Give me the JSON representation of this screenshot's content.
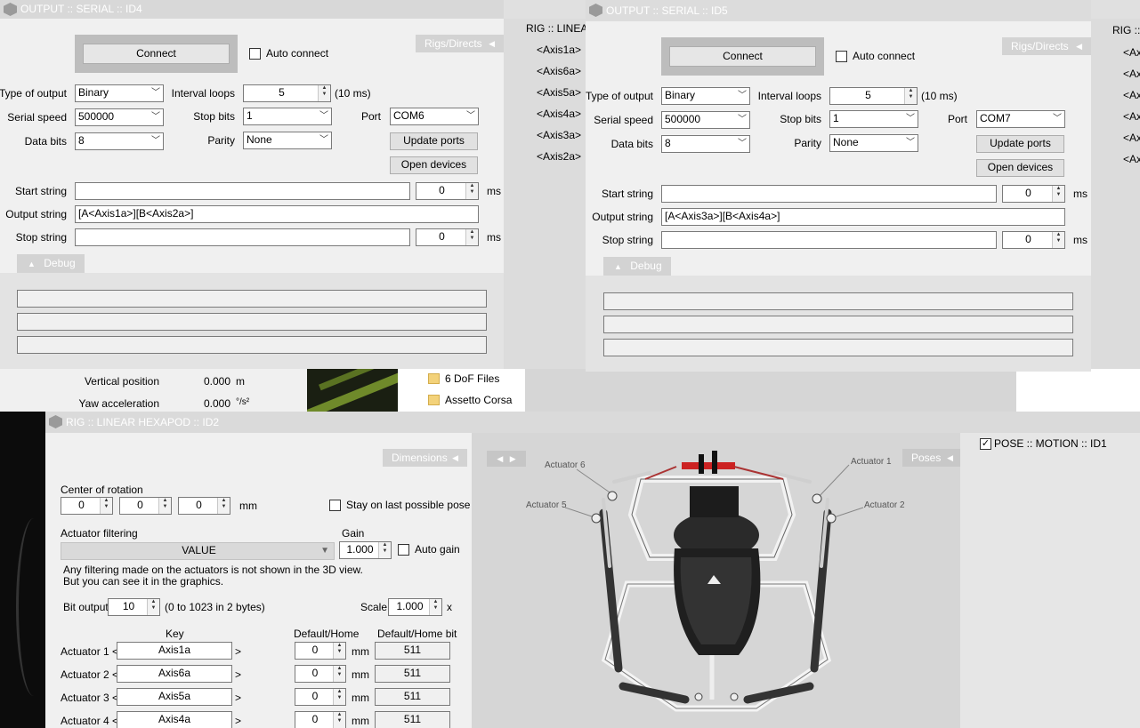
{
  "serial_id4": {
    "title": "OUTPUT :: SERIAL :: ID4",
    "connect_label": "Connect",
    "auto_connect_label": "Auto connect",
    "rigs_tab": "Rigs/Directs",
    "type_output_label": "Type of output",
    "type_output_value": "Binary",
    "interval_label": "Interval loops",
    "interval_value": "5",
    "interval_unit": "(10 ms)",
    "speed_label": "Serial speed",
    "speed_value": "500000",
    "stopbits_label": "Stop bits",
    "stopbits_value": "1",
    "port_label": "Port",
    "port_value": "COM6",
    "databits_label": "Data bits",
    "databits_value": "8",
    "parity_label": "Parity",
    "parity_value": "None",
    "update_ports_label": "Update ports",
    "open_devices_label": "Open devices",
    "start_label": "Start string",
    "start_value": "",
    "start_ms": "0",
    "output_label": "Output string",
    "output_value": "[A<Axis1a>][B<Axis2a>]",
    "stop_label": "Stop string",
    "stop_value": "",
    "stop_ms": "0",
    "ms": "ms",
    "debug_tab": "Debug"
  },
  "serial_id5": {
    "title": "OUTPUT :: SERIAL :: ID5",
    "connect_label": "Connect",
    "auto_connect_label": "Auto connect",
    "rigs_tab": "Rigs/Directs",
    "type_output_label": "Type of output",
    "type_output_value": "Binary",
    "interval_label": "Interval loops",
    "interval_value": "5",
    "interval_unit": "(10 ms)",
    "speed_label": "Serial speed",
    "speed_value": "500000",
    "stopbits_label": "Stop bits",
    "stopbits_value": "1",
    "port_label": "Port",
    "port_value": "COM7",
    "databits_label": "Data bits",
    "databits_value": "8",
    "parity_label": "Parity",
    "parity_value": "None",
    "update_ports_label": "Update ports",
    "open_devices_label": "Open devices",
    "start_label": "Start string",
    "start_value": "",
    "start_ms": "0",
    "output_label": "Output string",
    "output_value": "[A<Axis3a>][B<Axis4a>]",
    "stop_label": "Stop string",
    "stop_value": "",
    "stop_ms": "0",
    "ms": "ms",
    "debug_tab": "Debug"
  },
  "rig_list_left": {
    "title": "RIG :: LINEAF",
    "items": [
      "<Axis1a>",
      "<Axis6a>",
      "<Axis5a>",
      "<Axis4a>",
      "<Axis3a>",
      "<Axis2a>"
    ]
  },
  "rig_list_right": {
    "title": "RIG ::",
    "items": [
      "<Ax",
      "<Ax",
      "<Ax",
      "<Ax",
      "<Ax",
      "<Ax"
    ]
  },
  "telemetry": {
    "vertical_position_label": "Vertical position",
    "vertical_position_value": "0.000",
    "vertical_position_unit": "m",
    "yaw_accel_label": "Yaw acceleration",
    "yaw_accel_value": "0.000",
    "yaw_accel_unit": "°/s²"
  },
  "files": {
    "items": [
      "6 DoF Files",
      "Assetto Corsa"
    ]
  },
  "rig_id2": {
    "title": "RIG :: LINEAR HEXAPOD :: ID2",
    "dimensions_tab": "Dimensions",
    "poses_tab": "Poses",
    "center_label": "Center of rotation",
    "center_x": "0",
    "center_y": "0",
    "center_z": "0",
    "mm": "mm",
    "stay_label": "Stay on last possible pose",
    "filter_label": "Actuator filtering",
    "filter_value": "VALUE",
    "gain_label": "Gain",
    "gain_value": "1.000",
    "auto_gain_label": "Auto gain",
    "note_line1": "Any filtering made on the actuators is not shown in the 3D view.",
    "note_line2": "But you can see it in the graphics.",
    "bit_output_label": "Bit output",
    "bit_output_value": "10",
    "bit_output_range": "(0 to 1023 in 2 bytes)",
    "scale_label": "Scale",
    "scale_value": "1.000",
    "scale_unit": "x",
    "col_key": "Key",
    "col_default": "Default/Home",
    "col_default_bit": "Default/Home bit",
    "actuators": [
      {
        "label": "Actuator 1 <",
        "key": "Axis1a",
        "default": "0",
        "bit": "511"
      },
      {
        "label": "Actuator 2 <",
        "key": "Axis6a",
        "default": "0",
        "bit": "511"
      },
      {
        "label": "Actuator 3 <",
        "key": "Axis5a",
        "default": "0",
        "bit": "511"
      },
      {
        "label": "Actuator 4 <",
        "key": "Axis4a",
        "default": "0",
        "bit": "511"
      }
    ],
    "close_bracket": ">",
    "act_labels": [
      "Actuator 6",
      "Actuator 1",
      "Actuator 5",
      "Actuator 2"
    ]
  },
  "pose_motion": {
    "checked": "✓",
    "label": "POSE :: MOTION :: ID1"
  }
}
